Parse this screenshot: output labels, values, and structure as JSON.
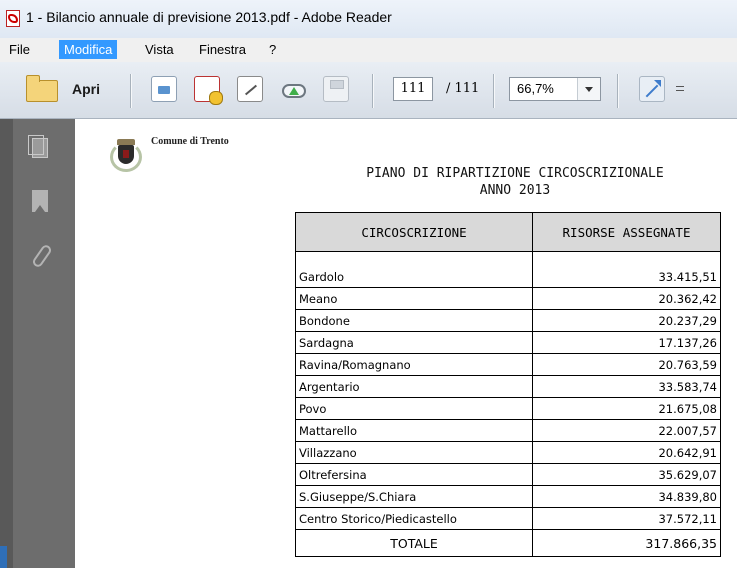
{
  "window": {
    "title": "1 - Bilancio annuale di previsione 2013.pdf - Adobe Reader"
  },
  "menu": [
    {
      "label": "File",
      "active": false
    },
    {
      "label": "Modifica",
      "active": true
    },
    {
      "label": "Vista",
      "active": false
    },
    {
      "label": "Finestra",
      "active": false
    },
    {
      "label": "?",
      "active": false
    }
  ],
  "toolbar": {
    "open_label": "Apri",
    "page_current": "111",
    "page_total": "/ 111",
    "zoom": "66,7%",
    "icons": [
      "open-folder-icon",
      "export-icon",
      "create-pdf-icon",
      "sign-icon",
      "upload-cloud-icon",
      "save-icon",
      "fullscreen-icon",
      "toolbar-menu-icon"
    ]
  },
  "sidebar": {
    "icons": [
      "pages-icon",
      "bookmark-icon",
      "attachment-icon"
    ]
  },
  "document": {
    "header": "Comune di Trento",
    "title": "PIANO DI RIPARTIZIONE CIRCOSCRIZIONALE",
    "subtitle": "ANNO 2013",
    "table": {
      "headers": [
        "CIRCOSCRIZIONE",
        "RISORSE ASSEGNATE"
      ],
      "rows": [
        [
          "Gardolo",
          "33.415,51"
        ],
        [
          "Meano",
          "20.362,42"
        ],
        [
          "Bondone",
          "20.237,29"
        ],
        [
          "Sardagna",
          "17.137,26"
        ],
        [
          "Ravina/Romagnano",
          "20.763,59"
        ],
        [
          "Argentario",
          "33.583,74"
        ],
        [
          "Povo",
          "21.675,08"
        ],
        [
          "Mattarello",
          "22.007,57"
        ],
        [
          "Villazzano",
          "20.642,91"
        ],
        [
          "Oltrefersina",
          "35.629,07"
        ],
        [
          "S.Giuseppe/S.Chiara",
          "34.839,80"
        ],
        [
          "Centro Storico/Piedicastello",
          "37.572,11"
        ]
      ],
      "total_label": "TOTALE",
      "total_value": "317.866,35"
    }
  },
  "colors": {
    "menu_highlight": "#3399ff",
    "sidebar": "#6d6d6d",
    "header_fill": "#d9d9d9"
  }
}
